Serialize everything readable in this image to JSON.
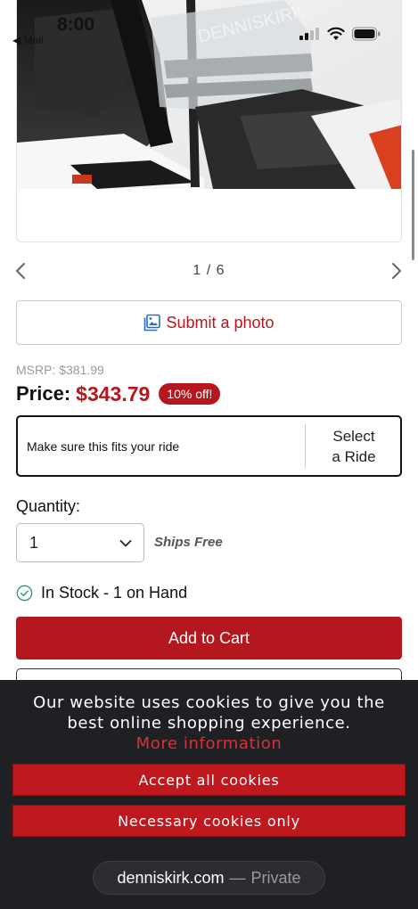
{
  "status_bar": {
    "time": "8:00",
    "back_app": "◀ Mail",
    "signal_icon": "cellular-signal-icon",
    "wifi_icon": "wifi-icon",
    "battery_icon": "battery-icon"
  },
  "gallery": {
    "watermark": "DENNISKIRK",
    "counter": "1 / 6",
    "prev_icon": "chevron-left-icon",
    "next_icon": "chevron-right-icon"
  },
  "submit_photo": {
    "label": "Submit a photo",
    "icon": "image-icon"
  },
  "pricing": {
    "msrp": "MSRP: $381.99",
    "price_label": "Price:",
    "price_value": "$343.79",
    "discount": "10% off!"
  },
  "fitment": {
    "text": "Make sure this fits your ride",
    "button": "Select\na Ride"
  },
  "quantity": {
    "label": "Quantity:",
    "selected": "1",
    "shipping": "Ships Free"
  },
  "stock": {
    "text": "In Stock - 1 on Hand",
    "icon": "check-circle-icon"
  },
  "cart": {
    "add_label": "Add to Cart"
  },
  "cookie_banner": {
    "message": "Our website uses cookies to give you the best online shopping experience.",
    "more_info": "More information",
    "accept_all": "Accept all cookies",
    "necessary_only": "Necessary cookies only"
  },
  "url_bar": {
    "domain": "denniskirk.com",
    "separator": "—",
    "mode": "Private"
  },
  "colors": {
    "brand_red": "#b5171e",
    "banner_bg": "#1f2024",
    "link_red": "#d6323a"
  }
}
